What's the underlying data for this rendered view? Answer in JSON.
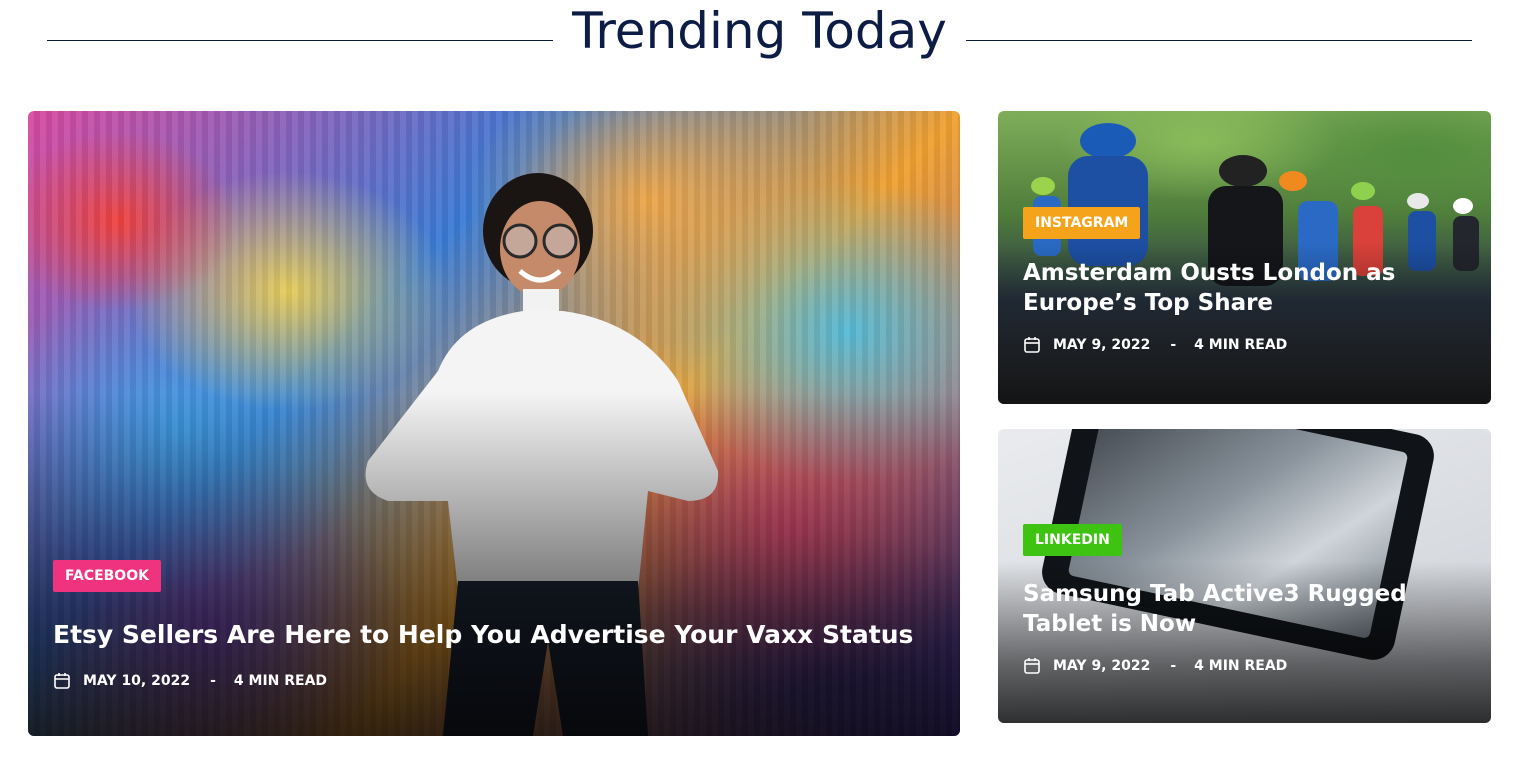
{
  "section": {
    "title": "Trending Today"
  },
  "posts": [
    {
      "category": "FACEBOOK",
      "category_color": "#f0337f",
      "title": "Etsy Sellers Are Here to Help You Advertise Your Vaxx Status",
      "date": "MAY 10, 2022",
      "separator": "-",
      "read_time": "4 MIN READ",
      "icon": "calendar-icon"
    },
    {
      "category": "INSTAGRAM",
      "category_color": "#f5a31b",
      "title": "Amsterdam Ousts London as Europe’s Top Share",
      "date": "MAY 9, 2022",
      "separator": "-",
      "read_time": "4 MIN READ",
      "icon": "calendar-icon"
    },
    {
      "category": "LINKEDIN",
      "category_color": "#3ec313",
      "title": "Samsung Tab Active3 Rugged Tablet is Now",
      "date": "MAY 9, 2022",
      "separator": "-",
      "read_time": "4 MIN READ",
      "icon": "calendar-icon"
    }
  ],
  "colors": {
    "heading": "#0c1c44",
    "rule": "#0b1a3a",
    "text_on_image": "#ffffff"
  }
}
